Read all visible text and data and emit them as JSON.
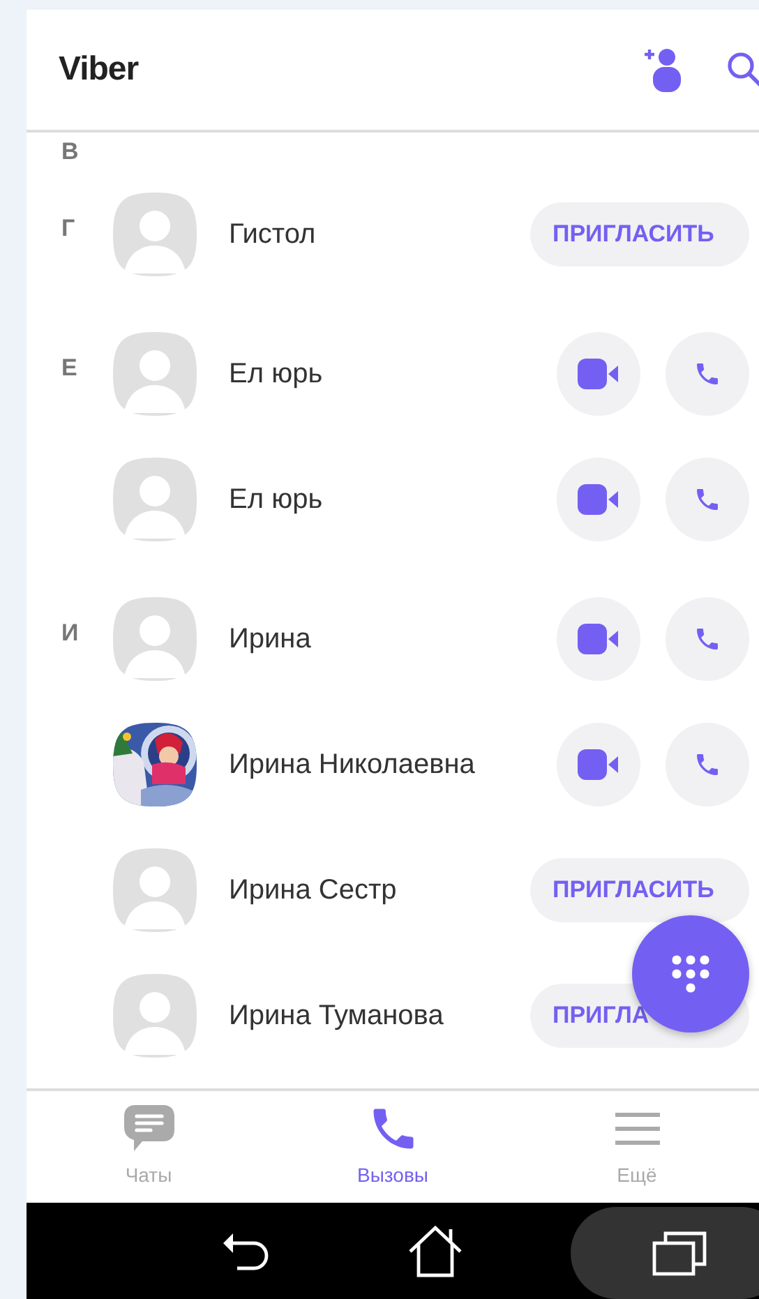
{
  "app_bar": {
    "title": "Viber"
  },
  "sections": [
    {
      "letter": "В"
    },
    {
      "letter": "Г",
      "contacts": [
        {
          "name": "Гистол",
          "has_photo": false,
          "kind": "invite",
          "invite_label": "ПРИГЛАСИТЬ"
        }
      ]
    },
    {
      "letter": "Е",
      "contacts": [
        {
          "name": "Ел юрь",
          "has_photo": false,
          "kind": "viber"
        },
        {
          "name": "Ел юрь",
          "has_photo": false,
          "kind": "viber"
        }
      ]
    },
    {
      "letter": "И",
      "contacts": [
        {
          "name": "Ирина",
          "has_photo": false,
          "kind": "viber"
        },
        {
          "name": "Ирина Николаевна",
          "has_photo": true,
          "kind": "viber"
        },
        {
          "name": "Ирина Сестр",
          "has_photo": false,
          "kind": "invite",
          "invite_label": "ПРИГЛАСИТЬ"
        },
        {
          "name": "Ирина Туманова",
          "has_photo": false,
          "kind": "invite",
          "invite_label": "ПРИГЛА"
        }
      ]
    }
  ],
  "tabs": [
    {
      "label": "Чаты",
      "selected": false
    },
    {
      "label": "Вызовы",
      "selected": true
    },
    {
      "label": "Ещё",
      "selected": false
    }
  ],
  "nav_bar": {
    "buttons": [
      {
        "pressed": false
      },
      {
        "pressed": false
      },
      {
        "pressed": true
      }
    ]
  }
}
